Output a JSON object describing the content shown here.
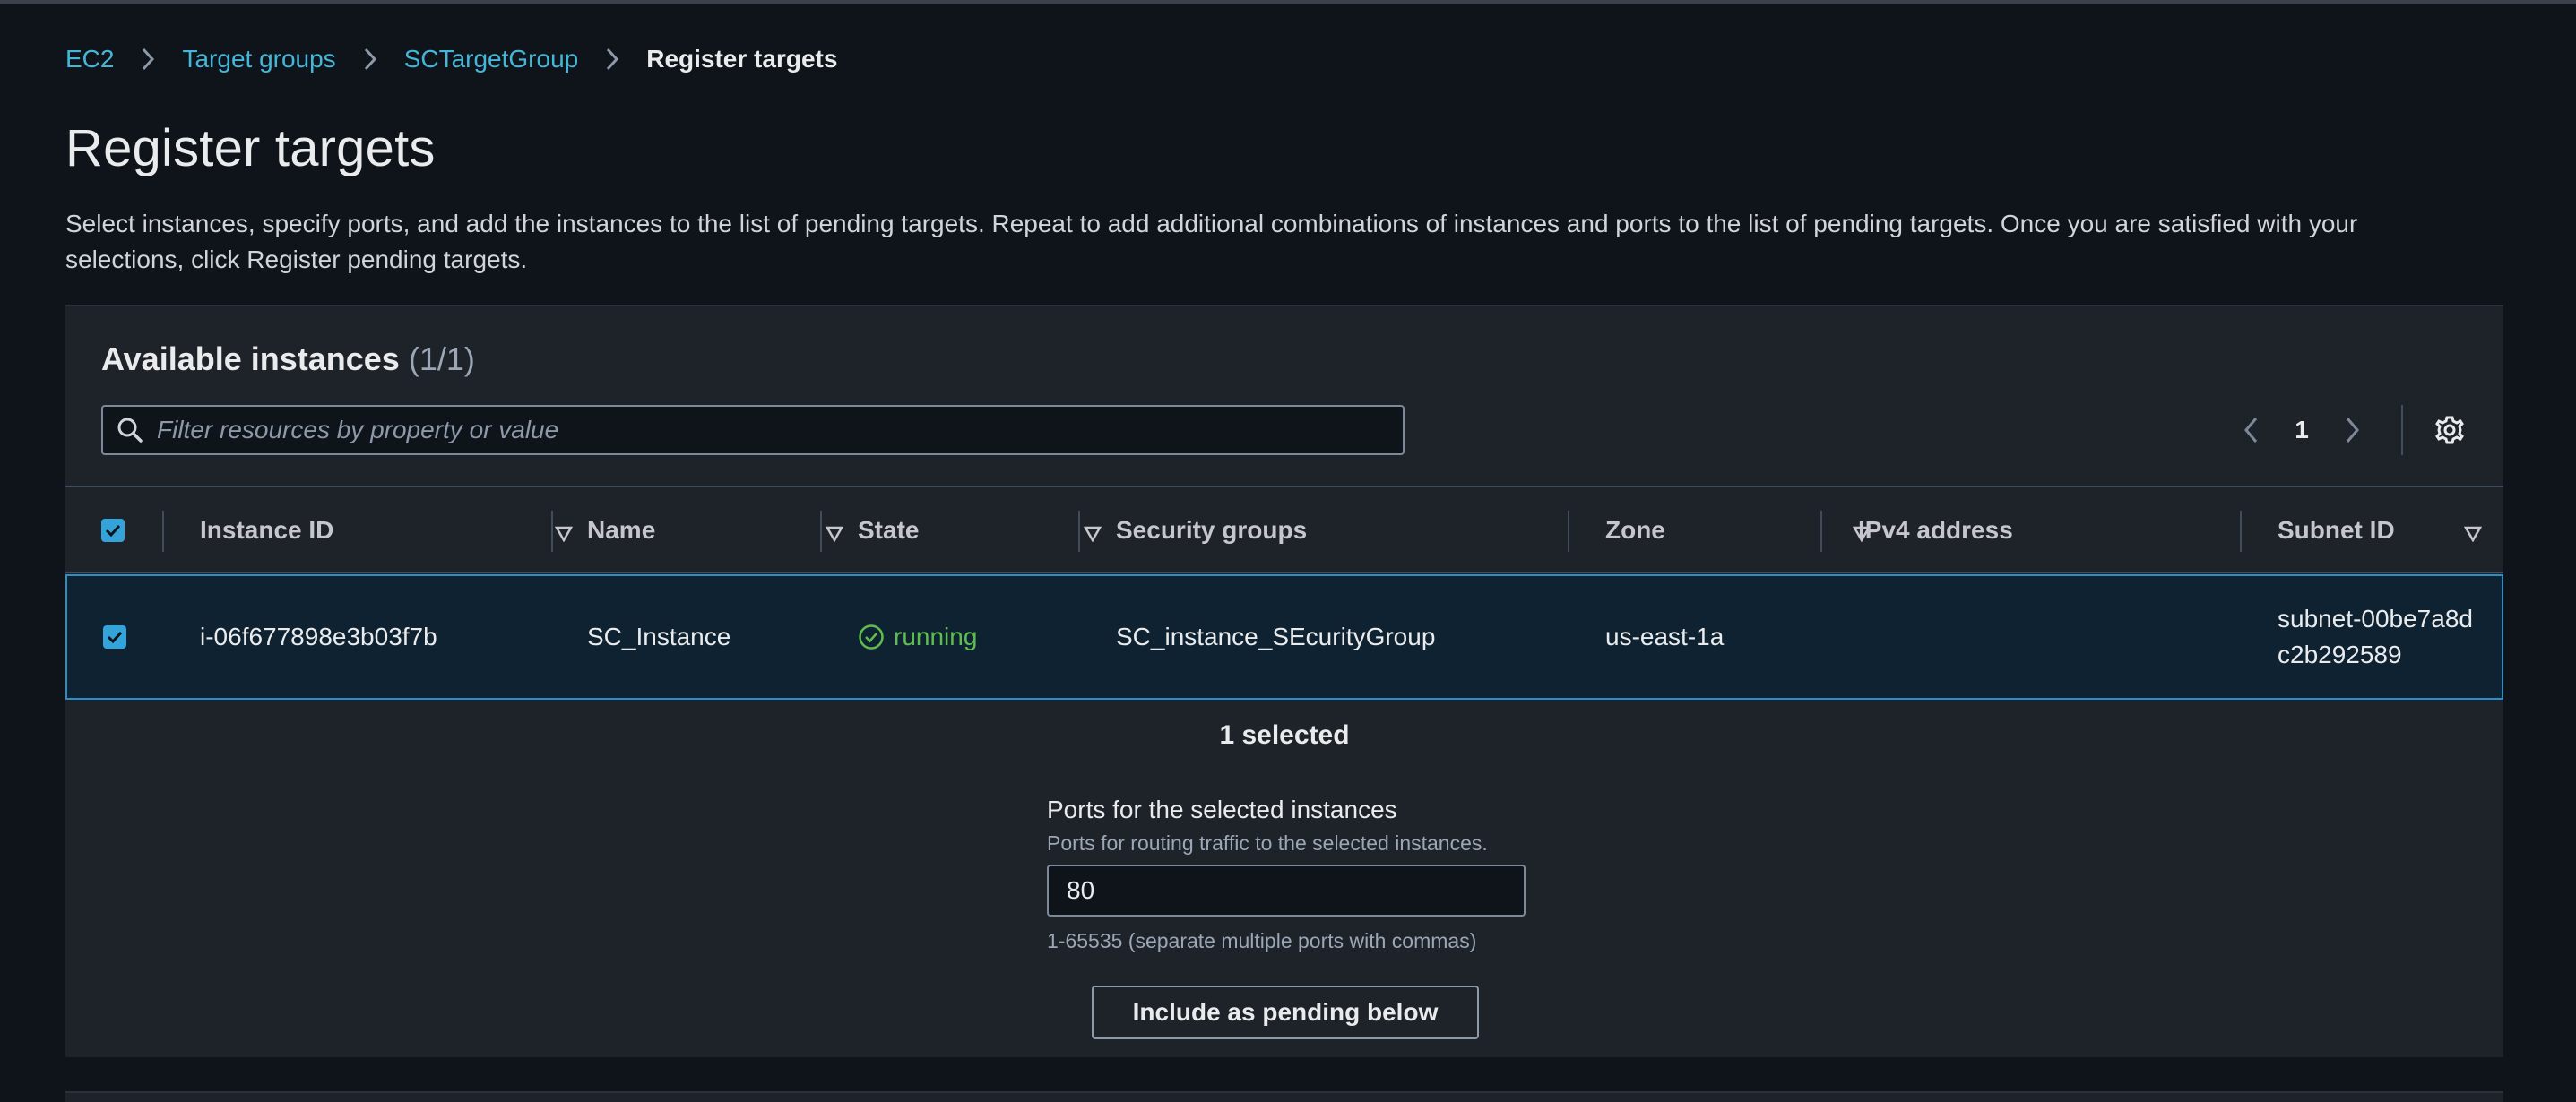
{
  "breadcrumb": {
    "items": [
      "EC2",
      "Target groups",
      "SCTargetGroup"
    ],
    "current": "Register targets"
  },
  "page": {
    "title": "Register targets",
    "description": "Select instances, specify ports, and add the instances to the list of pending targets. Repeat to add additional combinations of instances and ports to the list of pending targets. Once you are satisfied with your selections, click Register pending targets."
  },
  "instances": {
    "heading": "Available instances",
    "count": "(1/1)",
    "search_placeholder": "Filter resources by property or value",
    "page_number": "1",
    "columns": [
      "Instance ID",
      "Name",
      "State",
      "Security groups",
      "Zone",
      "IPv4 address",
      "Subnet ID"
    ],
    "rows": [
      {
        "instance_id": "i-06f677898e3b03f7b",
        "name": "SC_Instance",
        "state": "running",
        "security_groups": "SC_instance_SEcurityGroup",
        "zone": "us-east-1a",
        "ipv4": "",
        "subnet_id": "subnet-00be7a8dc2b292589"
      }
    ],
    "selected_text": "1 selected"
  },
  "ports": {
    "label": "Ports for the selected instances",
    "description": "Ports for routing traffic to the selected instances.",
    "value": "80",
    "hint": "1-65535 (separate multiple ports with commas)"
  },
  "actions": {
    "include_label": "Include as pending below"
  },
  "colors": {
    "link": "#45b6d8",
    "accent_checkbox": "#33a3d9",
    "running": "#5fbd4f",
    "selected_row_border": "#2a8fc7"
  },
  "icons": [
    "chevron-right-icon",
    "search-icon",
    "chevron-left-icon",
    "gear-icon",
    "sort-caret-icon",
    "checkbox-checked-icon",
    "status-success-icon"
  ]
}
